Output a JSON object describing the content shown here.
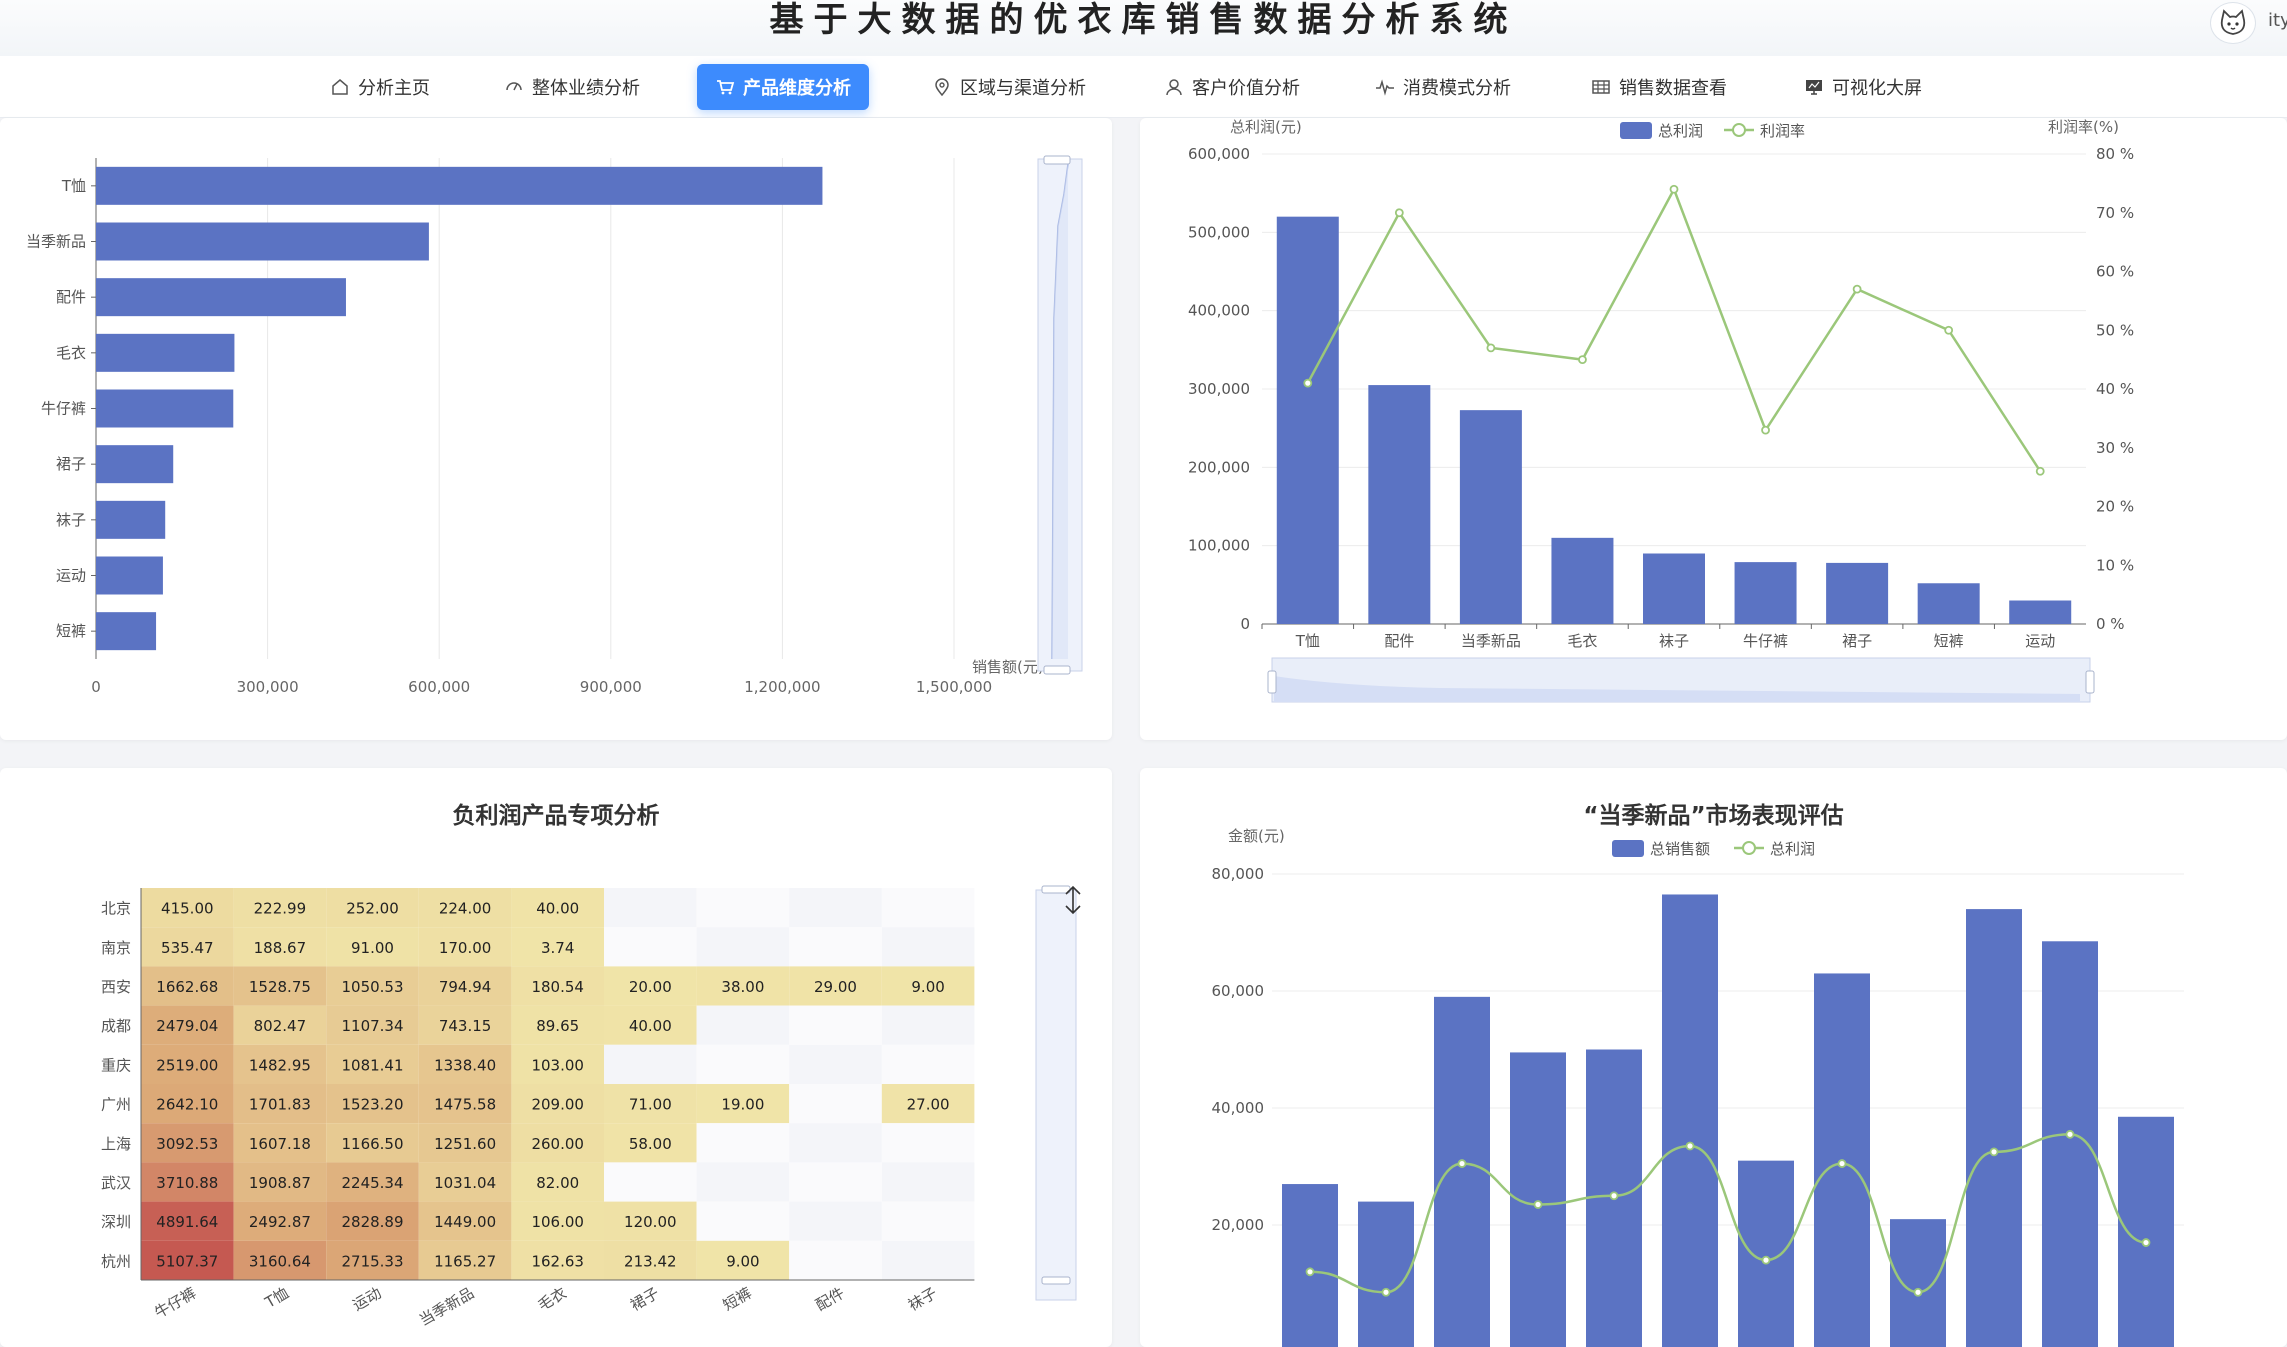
{
  "header": {
    "title": "基于大数据的优衣库销售数据分析系统",
    "username_fragment": "ity"
  },
  "nav": [
    {
      "label": "分析主页",
      "icon": "home-icon"
    },
    {
      "label": "整体业绩分析",
      "icon": "dashboard-icon"
    },
    {
      "label": "产品维度分析",
      "icon": "cart-icon",
      "active": true
    },
    {
      "label": "区域与渠道分析",
      "icon": "location-icon"
    },
    {
      "label": "客户价值分析",
      "icon": "user-icon"
    },
    {
      "label": "消费模式分析",
      "icon": "pulse-icon"
    },
    {
      "label": "销售数据查看",
      "icon": "table-icon"
    },
    {
      "label": "可视化大屏",
      "icon": "screen-icon"
    }
  ],
  "colors": {
    "bar": "#5b73c3",
    "line": "#9bc77a",
    "accent": "#3d8bfd"
  },
  "sales_chart": {
    "chart_data": {
      "type": "bar",
      "orientation": "horizontal",
      "categories": [
        "T恤",
        "当季新品",
        "配件",
        "毛衣",
        "牛仔裤",
        "裙子",
        "袜子",
        "运动",
        "短裤"
      ],
      "values": [
        1270000,
        582000,
        437000,
        242000,
        240000,
        135000,
        121000,
        117000,
        105000
      ],
      "xlabel": "销售额(元)",
      "xticks": [
        "0",
        "300,000",
        "600,000",
        "900,000",
        "1,200,000",
        "1,500,000"
      ],
      "xlim": [
        0,
        1500000
      ]
    }
  },
  "profit_chart": {
    "chart_data": {
      "type": "bar",
      "categories": [
        "T恤",
        "配件",
        "当季新品",
        "毛衣",
        "袜子",
        "牛仔裤",
        "裙子",
        "短裤",
        "运动"
      ],
      "series": [
        {
          "name": "总利润",
          "type": "bar",
          "values": [
            520000,
            305000,
            273000,
            110000,
            90000,
            79000,
            78000,
            52000,
            30000
          ]
        },
        {
          "name": "利润率",
          "type": "line",
          "axis": "right",
          "values": [
            41,
            70,
            47,
            45,
            74,
            33,
            57,
            50,
            26
          ]
        }
      ],
      "ylabel_left": "总利润(元)",
      "ylabel_right": "利润率(%)",
      "yticks_left": [
        "0",
        "100,000",
        "200,000",
        "300,000",
        "400,000",
        "500,000",
        "600,000"
      ],
      "yticks_right": [
        "0 %",
        "10 %",
        "20 %",
        "30 %",
        "40 %",
        "50 %",
        "60 %",
        "70 %",
        "80 %"
      ],
      "ylim_left": [
        0,
        600000
      ],
      "ylim_right": [
        0,
        80
      ],
      "legend": "top-center"
    }
  },
  "heatmap": {
    "title": "负利润产品专项分析",
    "chart_data": {
      "type": "heatmap",
      "rows": [
        "北京",
        "南京",
        "西安",
        "成都",
        "重庆",
        "广州",
        "上海",
        "武汉",
        "深圳",
        "杭州"
      ],
      "cols": [
        "牛仔裤",
        "T恤",
        "运动",
        "当季新品",
        "毛衣",
        "裙子",
        "短裤",
        "配件",
        "袜子"
      ],
      "values": [
        [
          "415.00",
          "222.99",
          "252.00",
          "224.00",
          "40.00",
          "",
          "",
          "",
          ""
        ],
        [
          "535.47",
          "188.67",
          "91.00",
          "170.00",
          "3.74",
          "",
          "",
          "",
          ""
        ],
        [
          "1662.68",
          "1528.75",
          "1050.53",
          "794.94",
          "180.54",
          "20.00",
          "38.00",
          "29.00",
          "9.00"
        ],
        [
          "2479.04",
          "802.47",
          "1107.34",
          "743.15",
          "89.65",
          "40.00",
          "",
          "",
          ""
        ],
        [
          "2519.00",
          "1482.95",
          "1081.41",
          "1338.40",
          "103.00",
          "",
          "",
          "",
          ""
        ],
        [
          "2642.10",
          "1701.83",
          "1523.20",
          "1475.58",
          "209.00",
          "71.00",
          "19.00",
          "",
          "27.00"
        ],
        [
          "3092.53",
          "1607.18",
          "1166.50",
          "1251.60",
          "260.00",
          "58.00",
          "",
          "",
          ""
        ],
        [
          "3710.88",
          "1908.87",
          "2245.34",
          "1031.04",
          "82.00",
          "",
          "",
          "",
          ""
        ],
        [
          "4891.64",
          "2492.87",
          "2828.89",
          "1449.00",
          "106.00",
          "120.00",
          "",
          "",
          ""
        ],
        [
          "5107.37",
          "3160.64",
          "2715.33",
          "1165.27",
          "162.63",
          "213.42",
          "9.00",
          "",
          ""
        ]
      ]
    }
  },
  "newitem_chart": {
    "title": "“当季新品”市场表现评估",
    "chart_data": {
      "type": "bar",
      "series": [
        {
          "name": "总销售额",
          "type": "bar",
          "values": [
            27000,
            24000,
            59000,
            49500,
            50000,
            76500,
            31000,
            63000,
            21000,
            74000,
            68500,
            38500
          ]
        },
        {
          "name": "总利润",
          "type": "line",
          "values": [
            12000,
            8500,
            30500,
            23500,
            25000,
            33500,
            14000,
            30500,
            8500,
            32500,
            35500,
            17000
          ]
        }
      ],
      "ylabel": "金额(元)",
      "yticks": [
        "20,000",
        "40,000",
        "60,000",
        "80,000"
      ],
      "ylim": [
        0,
        80000
      ],
      "legend": "top-center"
    }
  }
}
